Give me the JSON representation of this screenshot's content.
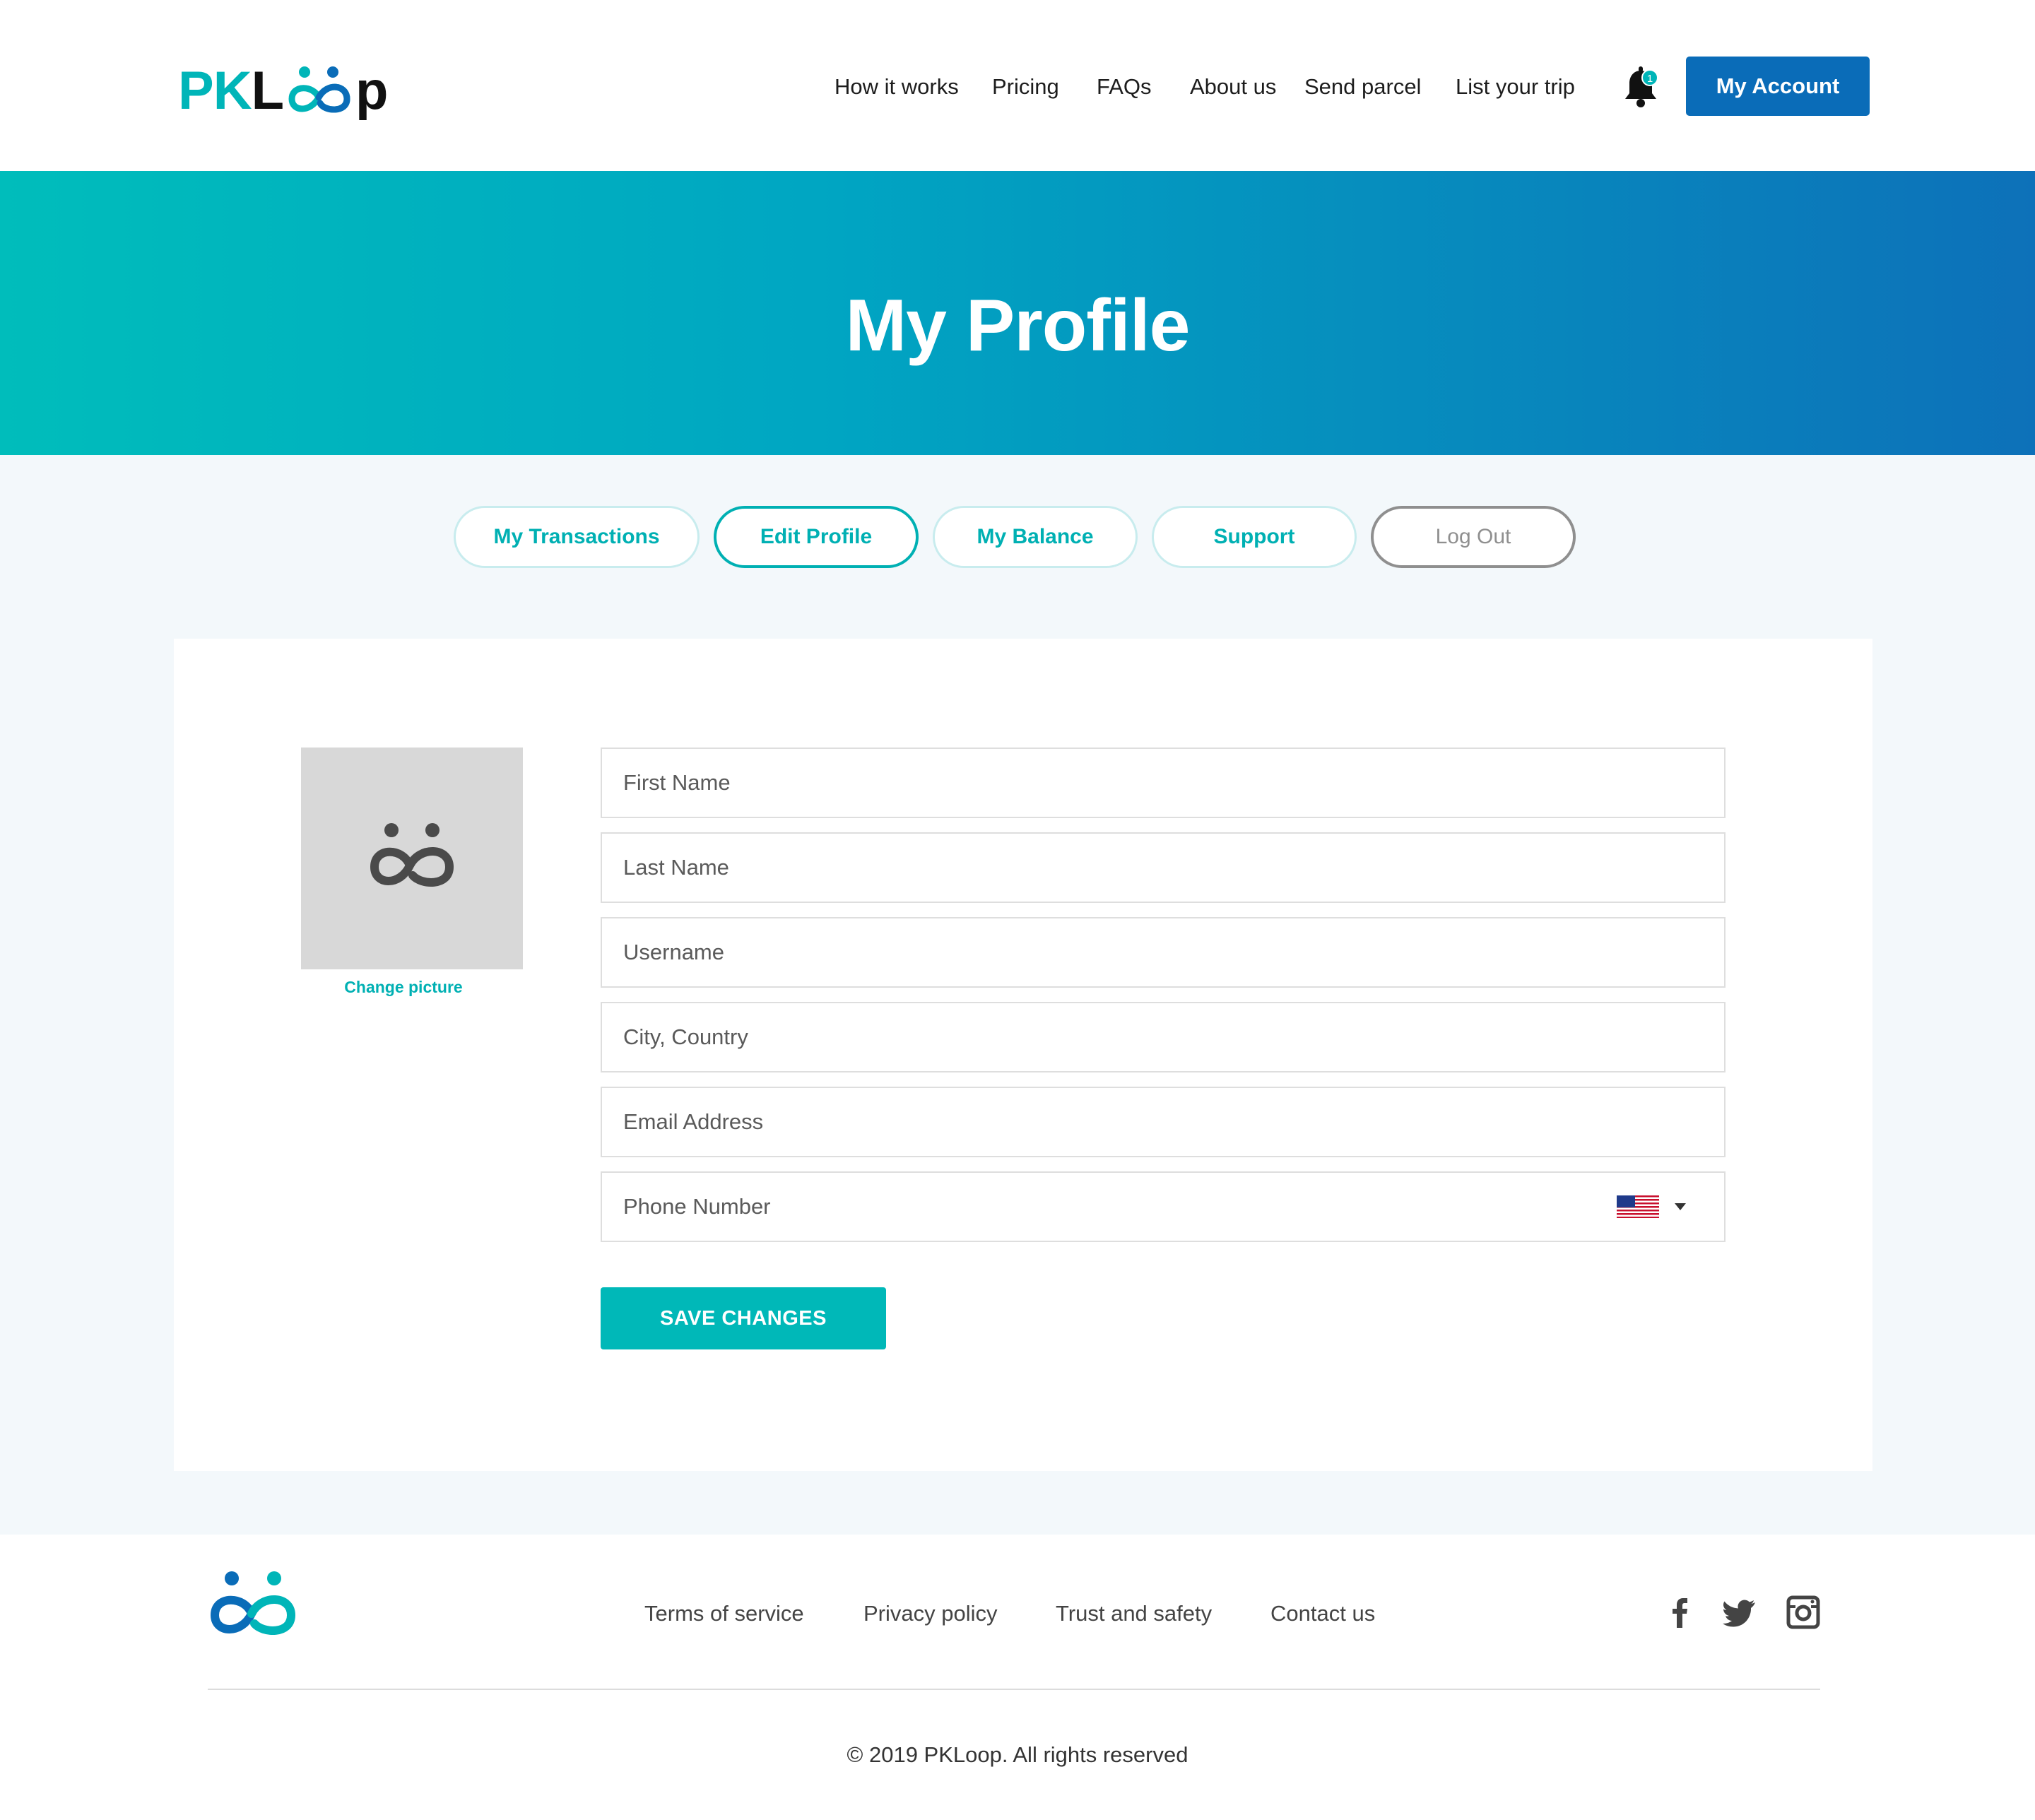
{
  "brand": {
    "name_part1": "PKL",
    "name_part2": "p",
    "accent_color": "#00b5b8",
    "primary_color": "#0a6cb8"
  },
  "nav": {
    "items": [
      "How it works",
      "Pricing",
      "FAQs",
      "About us",
      "Send parcel",
      "List your trip"
    ],
    "notification_count": "1",
    "account_label": "My Account"
  },
  "hero": {
    "title": "My Profile"
  },
  "tabs": [
    {
      "label": "My Transactions"
    },
    {
      "label": "Edit Profile"
    },
    {
      "label": "My Balance"
    },
    {
      "label": "Support"
    },
    {
      "label": "Log Out"
    }
  ],
  "profile": {
    "change_picture_label": "Change picture",
    "fields": {
      "first_name": {
        "placeholder": "First Name",
        "value": ""
      },
      "last_name": {
        "placeholder": "Last Name",
        "value": ""
      },
      "username": {
        "placeholder": "Username",
        "value": ""
      },
      "city_country": {
        "placeholder": "City, Country",
        "value": ""
      },
      "email": {
        "placeholder": "Email Address",
        "value": ""
      },
      "phone": {
        "placeholder": "Phone Number",
        "value": "",
        "country_flag": "us-flag-icon"
      }
    },
    "save_label": "SAVE CHANGES"
  },
  "footer": {
    "links": [
      "Terms of service",
      "Privacy policy",
      "Trust and safety",
      "Contact us"
    ],
    "social_icons": [
      "facebook-icon",
      "twitter-icon",
      "instagram-icon"
    ],
    "copyright": "© 2019 PKLoop. All rights reserved"
  }
}
